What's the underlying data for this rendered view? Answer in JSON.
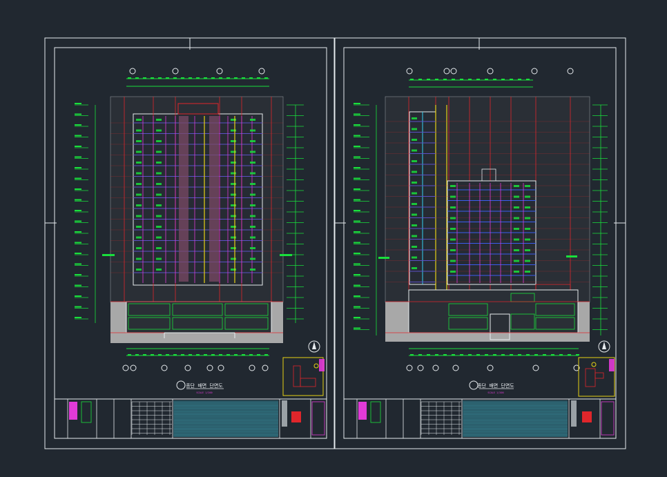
{
  "theme": {
    "background": "#212830",
    "frame": "#e8ecef",
    "green": "#19e03c",
    "red": "#e0262b",
    "magenta": "#e23ad8",
    "yellow": "#e8d214",
    "cyan": "#34d0f0",
    "blue": "#3a5cf0",
    "gray_fill": "#a8a8a8",
    "white": "#f2f2f2"
  },
  "sheets": [
    {
      "id": "left",
      "drawing_title": "종단 배면 단면도",
      "subtitle": "SCALE 1/200",
      "grid_bubbles": 4
    },
    {
      "id": "right",
      "drawing_title": "종단 배면 단면도",
      "subtitle": "SCALE 1/200",
      "grid_bubbles": 5
    }
  ]
}
